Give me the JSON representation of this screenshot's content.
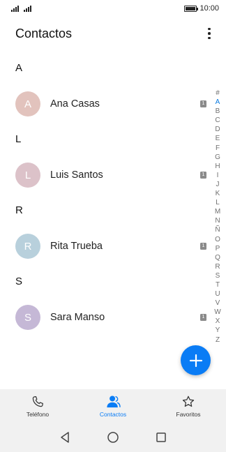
{
  "status_bar": {
    "time": "10:00"
  },
  "header": {
    "title": "Contactos"
  },
  "sections": [
    {
      "letter": "A",
      "contacts": [
        {
          "initial": "A",
          "name": "Ana Casas",
          "sim": "1",
          "color": "#e2c3bd"
        }
      ]
    },
    {
      "letter": "L",
      "contacts": [
        {
          "initial": "L",
          "name": "Luis Santos",
          "sim": "1",
          "color": "#dcc2c9"
        }
      ]
    },
    {
      "letter": "R",
      "contacts": [
        {
          "initial": "R",
          "name": "Rita Trueba",
          "sim": "1",
          "color": "#b8d0dc"
        }
      ]
    },
    {
      "letter": "S",
      "contacts": [
        {
          "initial": "S",
          "name": "Sara Manso",
          "sim": "1",
          "color": "#c5b8d6"
        }
      ]
    }
  ],
  "alphabet_index": [
    "#",
    "A",
    "B",
    "C",
    "D",
    "E",
    "F",
    "G",
    "H",
    "I",
    "J",
    "K",
    "L",
    "M",
    "N",
    "Ñ",
    "O",
    "P",
    "Q",
    "R",
    "S",
    "T",
    "U",
    "V",
    "W",
    "X",
    "Y",
    "Z"
  ],
  "alphabet_active": "A",
  "bottom_nav": [
    {
      "label": "Teléfono",
      "icon": "phone-icon",
      "active": false
    },
    {
      "label": "Contactos",
      "icon": "contacts-icon",
      "active": true
    },
    {
      "label": "Favoritos",
      "icon": "star-icon",
      "active": false
    }
  ],
  "colors": {
    "accent": "#0a7cf5",
    "nav_background": "#f1f1f1"
  }
}
